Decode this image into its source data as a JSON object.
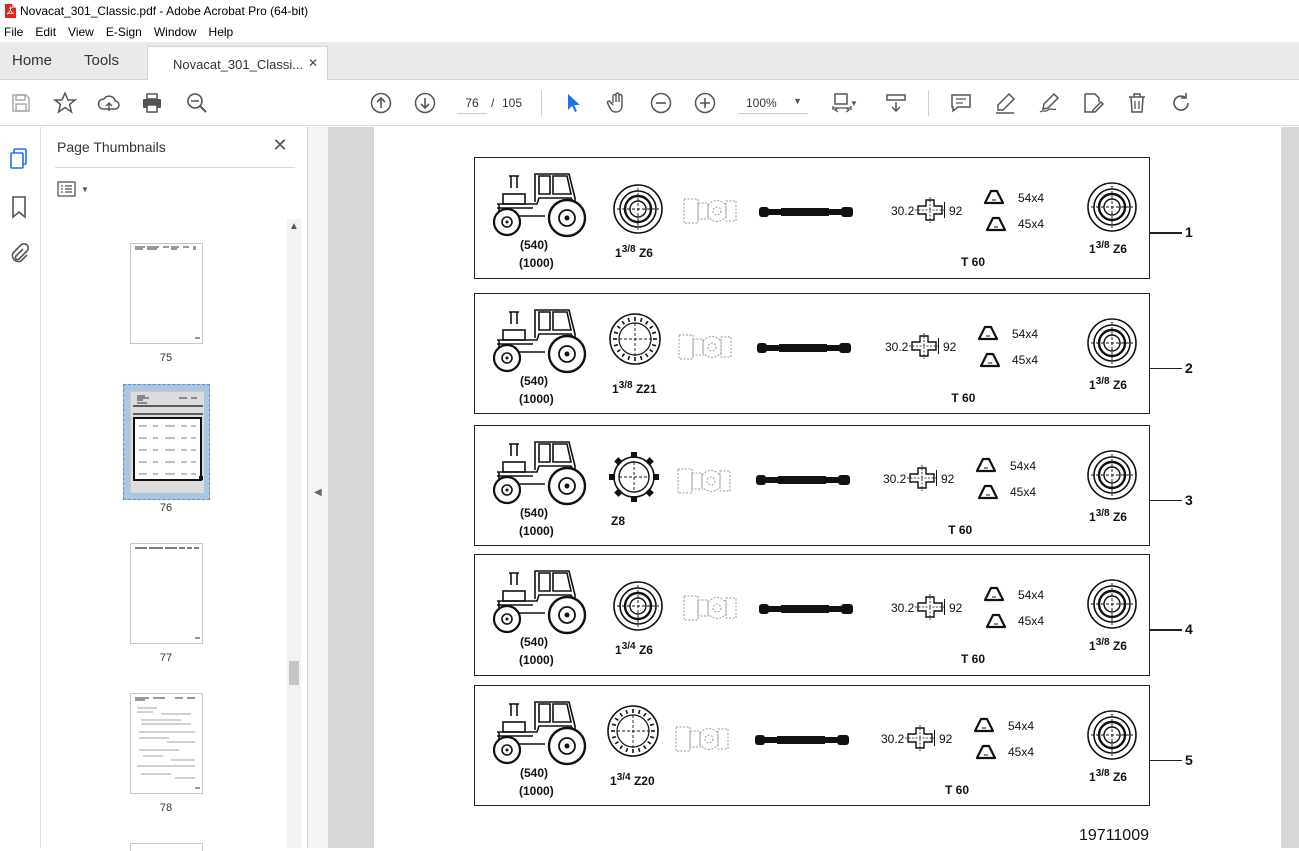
{
  "window": {
    "title": "Novacat_301_Classic.pdf - Adobe Acrobat Pro (64-bit)"
  },
  "menu": [
    "File",
    "Edit",
    "View",
    "E-Sign",
    "Window",
    "Help"
  ],
  "tabs": {
    "home": "Home",
    "tools": "Tools",
    "document": "Novacat_301_Classi..."
  },
  "toolbar": {
    "page_current": "76",
    "page_separator": "/",
    "page_total": "105",
    "zoom": "100%"
  },
  "panel": {
    "title": "Page Thumbnails"
  },
  "thumbnails": [
    {
      "label": "75"
    },
    {
      "label": "76",
      "selected": true
    },
    {
      "label": "77"
    },
    {
      "label": "78"
    }
  ],
  "document": {
    "rows": [
      {
        "number": "1",
        "speeds": [
          "(540)",
          "(1000)"
        ],
        "left_size": "1",
        "left_frac": "3/8",
        "left_spline": "Z6",
        "dim_left": "30.2",
        "dim_right": "92",
        "profile_a": "54x4",
        "profile_b": "45x4",
        "tube": "T 60",
        "right_size": "1",
        "right_frac": "3/8",
        "right_spline": "Z6"
      },
      {
        "number": "2",
        "speeds": [
          "(540)",
          "(1000)"
        ],
        "left_size": "1",
        "left_frac": "3/8",
        "left_spline": "Z21",
        "dim_left": "30.2",
        "dim_right": "92",
        "profile_a": "54x4",
        "profile_b": "45x4",
        "tube": "T 60",
        "right_size": "1",
        "right_frac": "3/8",
        "right_spline": "Z6"
      },
      {
        "number": "3",
        "speeds": [
          "(540)",
          "(1000)"
        ],
        "left_size": "",
        "left_frac": "",
        "left_spline": "Z8",
        "dim_left": "30.2",
        "dim_right": "92",
        "profile_a": "54x4",
        "profile_b": "45x4",
        "tube": "T 60",
        "right_size": "1",
        "right_frac": "3/8",
        "right_spline": "Z6"
      },
      {
        "number": "4",
        "speeds": [
          "(540)",
          "(1000)"
        ],
        "left_size": "1",
        "left_frac": "3/4",
        "left_spline": "Z6",
        "dim_left": "30.2",
        "dim_right": "92",
        "profile_a": "54x4",
        "profile_b": "45x4",
        "tube": "T 60",
        "right_size": "1",
        "right_frac": "3/8",
        "right_spline": "Z6"
      },
      {
        "number": "5",
        "speeds": [
          "(540)",
          "(1000)"
        ],
        "left_size": "1",
        "left_frac": "3/4",
        "left_spline": "Z20",
        "dim_left": "30.2",
        "dim_right": "92",
        "profile_a": "54x4",
        "profile_b": "45x4",
        "tube": "T 60",
        "right_size": "1",
        "right_frac": "3/8",
        "right_spline": "Z6"
      }
    ],
    "code": "19711009"
  }
}
